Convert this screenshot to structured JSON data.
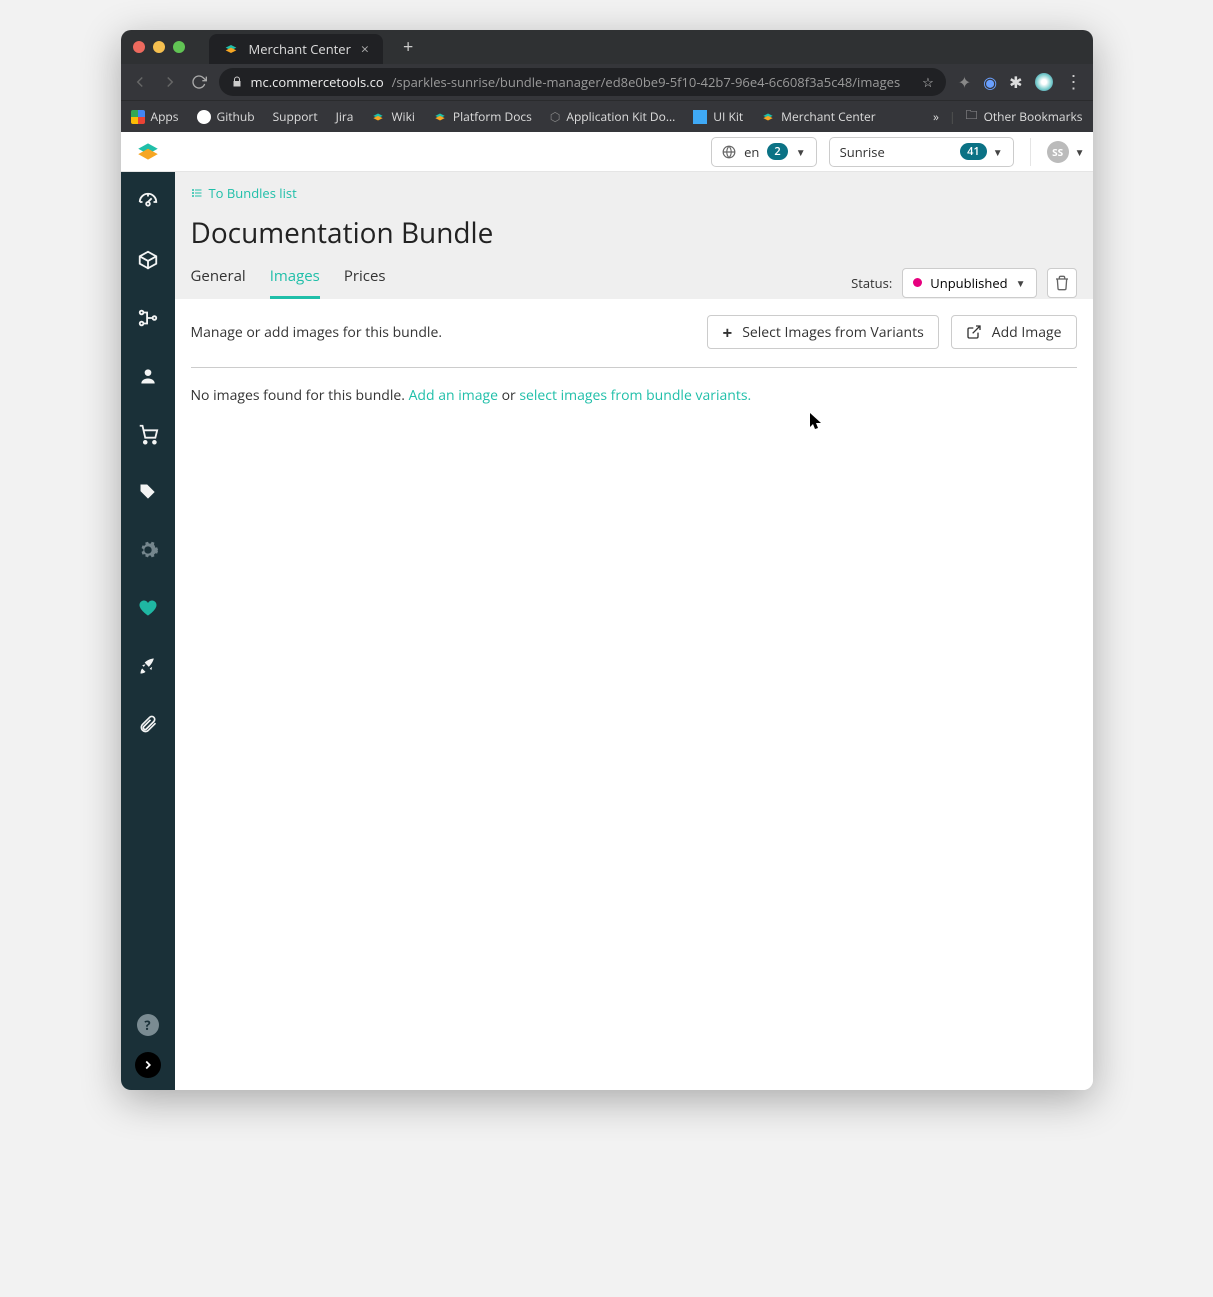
{
  "browser": {
    "tab_title": "Merchant Center",
    "url_host": "mc.commercetools.co",
    "url_path": "/sparkles-sunrise/bundle-manager/ed8e0be9-5f10-42b7-96e4-6c608f3a5c48/images",
    "bookmarks": {
      "apps": "Apps",
      "github": "Github",
      "support": "Support",
      "jira": "Jira",
      "wiki": "Wiki",
      "platform_docs": "Platform Docs",
      "app_kit": "Application Kit Do...",
      "ui_kit": "UI Kit",
      "merchant_center": "Merchant Center",
      "more": "»",
      "other": "Other Bookmarks"
    }
  },
  "header": {
    "locale": "en",
    "locale_badge": "2",
    "project": "Sunrise",
    "project_badge": "41",
    "avatar": "SS"
  },
  "sidebar_icons": [
    "dashboard",
    "package",
    "sitemap",
    "user",
    "cart",
    "tag",
    "gear",
    "heart",
    "rocket",
    "attach"
  ],
  "breadcrumb": {
    "label": "To Bundles list"
  },
  "page": {
    "title": "Documentation Bundle"
  },
  "tabs": [
    {
      "key": "general",
      "label": "General",
      "active": false
    },
    {
      "key": "images",
      "label": "Images",
      "active": true
    },
    {
      "key": "prices",
      "label": "Prices",
      "active": false
    }
  ],
  "status": {
    "label": "Status:",
    "value": "Unpublished",
    "color": "#e6007e"
  },
  "section": {
    "description": "Manage or add images for this bundle.",
    "select_variants": "Select Images from Variants",
    "add_image": "Add Image"
  },
  "empty": {
    "prefix": "No images found for this bundle. ",
    "add_link": "Add an image",
    "mid": " or ",
    "select_link": "select images from bundle variants."
  }
}
